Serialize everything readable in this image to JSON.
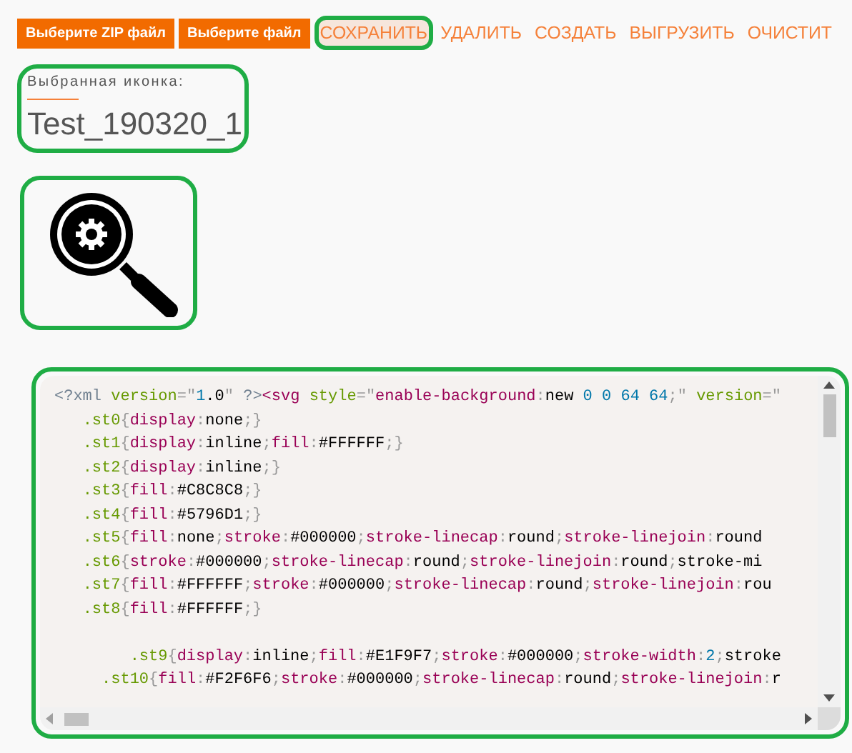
{
  "toolbar": {
    "buttons": [
      {
        "label": "Выберите ZIP файл"
      },
      {
        "label": "Выберите файл"
      }
    ],
    "actions": [
      {
        "label": "СОХРАНИТЬ",
        "highlighted": true,
        "hovered": true
      },
      {
        "label": "УДАЛИТЬ",
        "highlighted": false,
        "hovered": false
      },
      {
        "label": "СОЗДАТЬ",
        "highlighted": false,
        "hovered": false
      },
      {
        "label": "ВЫГРУЗИТЬ",
        "highlighted": false,
        "hovered": false
      },
      {
        "label": "ОЧИСТИТ",
        "highlighted": false,
        "hovered": false
      }
    ]
  },
  "selected_icon": {
    "label": "Выбранная иконка:",
    "name": "Test_190320_1",
    "highlighted": true
  },
  "preview": {
    "highlighted": true
  },
  "source_code": {
    "highlighted": true,
    "lines": [
      {
        "text": "<?xml version=\"1.0\" ?><svg style=\"enable-background:new 0 0 64 64;\" version=\"",
        "gap_before": false
      },
      {
        "text": "   .st0{display:none;}",
        "gap_before": false
      },
      {
        "text": "   .st1{display:inline;fill:#FFFFFF;}",
        "gap_before": false
      },
      {
        "text": "   .st2{display:inline;}",
        "gap_before": false
      },
      {
        "text": "   .st3{fill:#C8C8C8;}",
        "gap_before": false
      },
      {
        "text": "   .st4{fill:#5796D1;}",
        "gap_before": false
      },
      {
        "text": "   .st5{fill:none;stroke:#000000;stroke-linecap:round;stroke-linejoin:round",
        "gap_before": false
      },
      {
        "text": "   .st6{stroke:#000000;stroke-linecap:round;stroke-linejoin:round;stroke-mi",
        "gap_before": false
      },
      {
        "text": "   .st7{fill:#FFFFFF;stroke:#000000;stroke-linecap:round;stroke-linejoin:rou",
        "gap_before": false
      },
      {
        "text": "   .st8{fill:#FFFFFF;}",
        "gap_before": false
      },
      {
        "text": "        .st9{display:inline;fill:#E1F9F7;stroke:#000000;stroke-width:2;stroke",
        "gap_before": true
      },
      {
        "text": "     .st10{fill:#F2F6F6;stroke:#000000;stroke-linecap:round;stroke-linejoin:r",
        "gap_before": false
      }
    ]
  }
}
